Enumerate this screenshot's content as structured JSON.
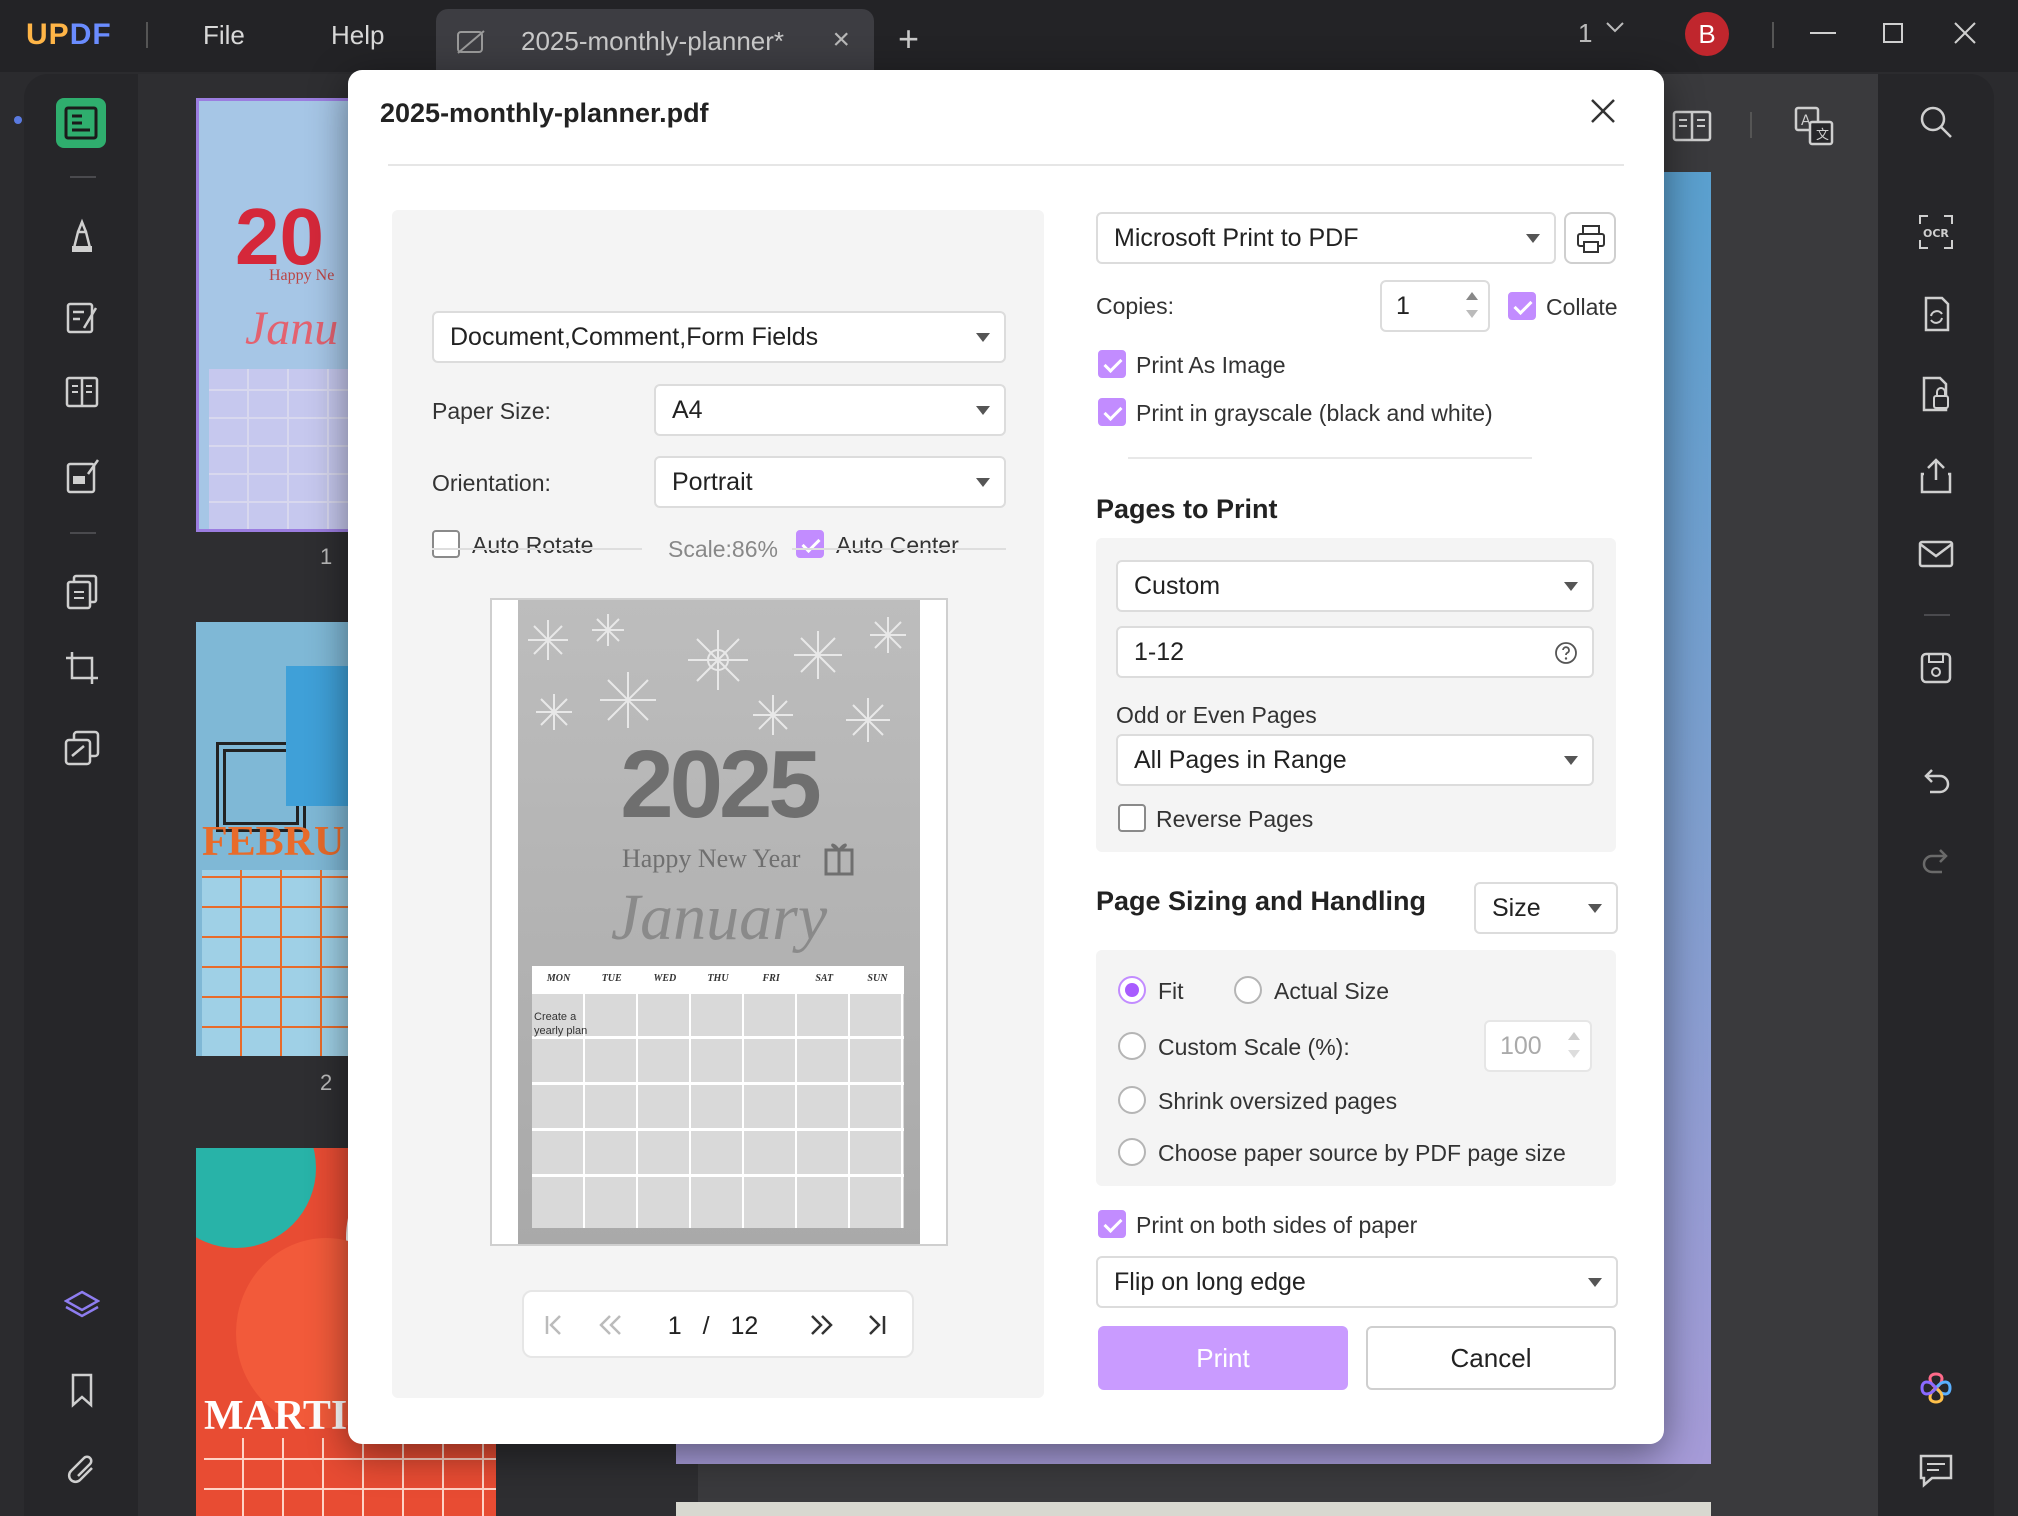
{
  "app": {
    "logo_main": "UPDF",
    "menu": [
      "File",
      "Help"
    ],
    "tab_title": "2025-monthly-planner*",
    "page_indicator": "1",
    "avatar_letter": "B",
    "thumb_numbers": [
      "1",
      "2"
    ]
  },
  "dialog": {
    "title": "2025-monthly-planner.pdf",
    "content_select": "Document,Comment,Form Fields",
    "paper_size_label": "Paper Size:",
    "paper_size_value": "A4",
    "orientation_label": "Orientation:",
    "orientation_value": "Portrait",
    "auto_rotate_label": "Auto Rotate",
    "auto_rotate_checked": false,
    "auto_center_label": "Auto Center",
    "auto_center_checked": true,
    "scale_text": "Scale:86%",
    "preview": {
      "year": "2025",
      "subtitle": "Happy New Year",
      "month": "January",
      "weekdays": [
        "MON",
        "TUE",
        "WED",
        "THU",
        "FRI",
        "SAT",
        "SUN"
      ],
      "note_line1": "Create a",
      "note_line2": "yearly plan"
    },
    "pager": {
      "current": "1",
      "separator": "/",
      "total": "12"
    },
    "printer_value": "Microsoft Print to PDF",
    "copies_label": "Copies:",
    "copies_value": "1",
    "collate_label": "Collate",
    "collate_checked": true,
    "print_as_image_label": "Print As Image",
    "print_as_image_checked": true,
    "grayscale_label": "Print in grayscale (black and white)",
    "grayscale_checked": true,
    "pages_to_print_title": "Pages to Print",
    "pages_mode": "Custom",
    "page_range": "1-12",
    "odd_even_label": "Odd or Even Pages",
    "odd_even_value": "All Pages in Range",
    "reverse_pages_label": "Reverse Pages",
    "reverse_pages_checked": false,
    "sizing_title": "Page Sizing and Handling",
    "sizing_mode": "Size",
    "fit_label": "Fit",
    "actual_size_label": "Actual Size",
    "custom_scale_label": "Custom Scale (%):",
    "custom_scale_value": "100",
    "shrink_label": "Shrink oversized pages",
    "paper_source_label": "Choose paper source by PDF page size",
    "selected_sizing": "Fit",
    "both_sides_label": "Print on both sides of paper",
    "both_sides_checked": true,
    "flip_value": "Flip on long edge",
    "print_button": "Print",
    "cancel_button": "Cancel"
  },
  "colors": {
    "accent": "#c99bff",
    "accent_dark": "#a85cff",
    "logo_orange": "#ffb547",
    "logo_blue": "#6a8cff",
    "avatar_red": "#c0262d"
  }
}
